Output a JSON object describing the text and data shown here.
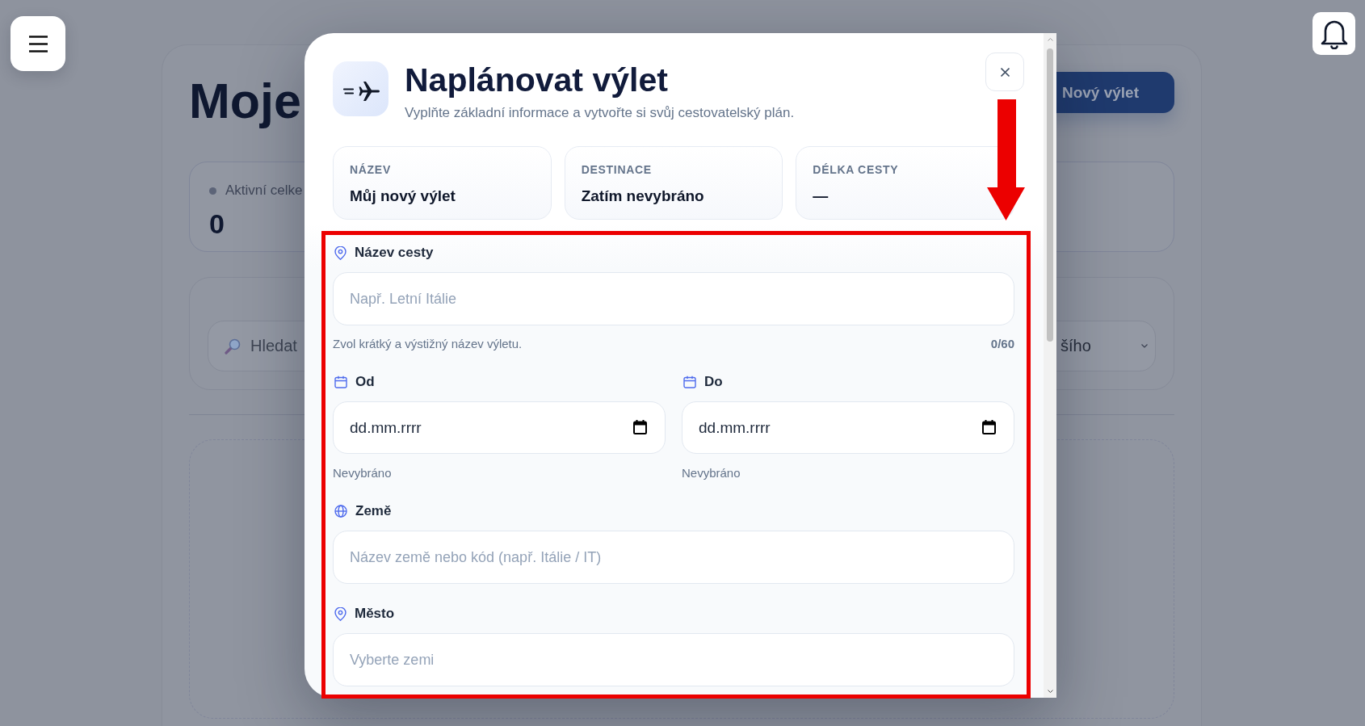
{
  "page": {
    "heading": "Moje",
    "new_trip_button": "Nový výlet",
    "stat": {
      "label": "Aktivní celke",
      "value": "0"
    },
    "search": {
      "placeholder": "Hledat"
    },
    "sort_select": {
      "value": "šího"
    }
  },
  "modal": {
    "title": "Naplánovat výlet",
    "subtitle": "Vyplňte základní informace a vytvořte si svůj cestovatelský plán.",
    "summary": [
      {
        "label": "NÁZEV",
        "value": "Můj nový výlet"
      },
      {
        "label": "DESTINACE",
        "value": "Zatím nevybráno"
      },
      {
        "label": "DÉLKA CESTY",
        "value": "—"
      }
    ],
    "fields": [
      {
        "kind": "location",
        "label": "Název cesty",
        "placeholder": "Např. Letní Itálie",
        "hint": "Zvol krátký a výstižný název výletu.",
        "counter": "0/60"
      },
      {
        "kind": "dates",
        "items": [
          {
            "label": "Od",
            "placeholder": "dd.mm.rrrr",
            "status": "Nevybráno"
          },
          {
            "label": "Do",
            "placeholder": "dd.mm.rrrr",
            "status": "Nevybráno"
          }
        ]
      },
      {
        "kind": "country",
        "label": "Země",
        "placeholder": "Název země nebo kód (např. Itálie / IT)"
      },
      {
        "kind": "location",
        "label": "Město",
        "placeholder": "Vyberte zemi"
      }
    ]
  }
}
